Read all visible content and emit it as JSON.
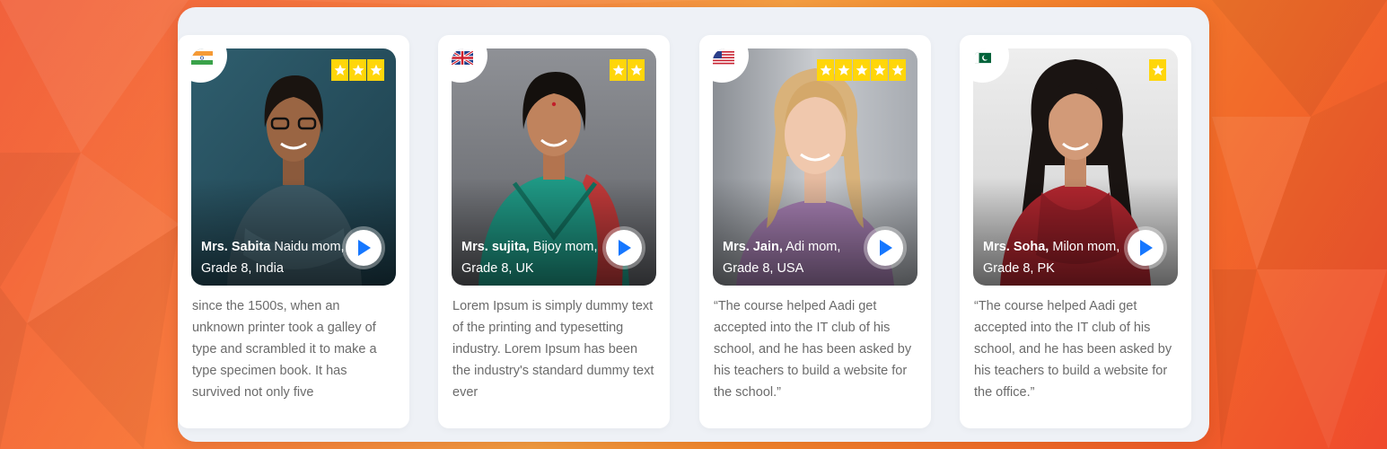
{
  "colors": {
    "star": "#ffd60a",
    "play_icon": "#1677ff",
    "quote_text": "#6b6b6b",
    "panel_bg": "#eef1f6"
  },
  "testimonials": [
    {
      "flag_icon": "india-flag-icon",
      "rating": 3,
      "name": "Mrs. Sabita",
      "detail": "Naidu mom, Grade 8, India",
      "quote": "since the 1500s, when an unknown printer took a galley of type and scrambled it to make a type specimen book. It has survived not only five"
    },
    {
      "flag_icon": "uk-flag-icon",
      "rating": 2,
      "name": "Mrs. sujita,",
      "detail": "Bijoy mom, Grade 8, UK",
      "quote": "Lorem Ipsum is simply dummy text of the printing and typesetting industry. Lorem Ipsum has been the industry's standard dummy text ever"
    },
    {
      "flag_icon": "usa-flag-icon",
      "rating": 5,
      "name": "Mrs. Jain,",
      "detail": "Adi mom, Grade 8, USA",
      "quote": "“The course helped Aadi get accepted into the IT club of his school, and he has been asked by his teachers to build a website for the school.”"
    },
    {
      "flag_icon": "pakistan-flag-icon",
      "rating": 1,
      "name": "Mrs. Soha,",
      "detail": "Milon mom, Grade 8, PK",
      "quote": "“The course helped Aadi get accepted into the IT club of his school, and he has been asked by his teachers to build a website for the office.”"
    }
  ]
}
